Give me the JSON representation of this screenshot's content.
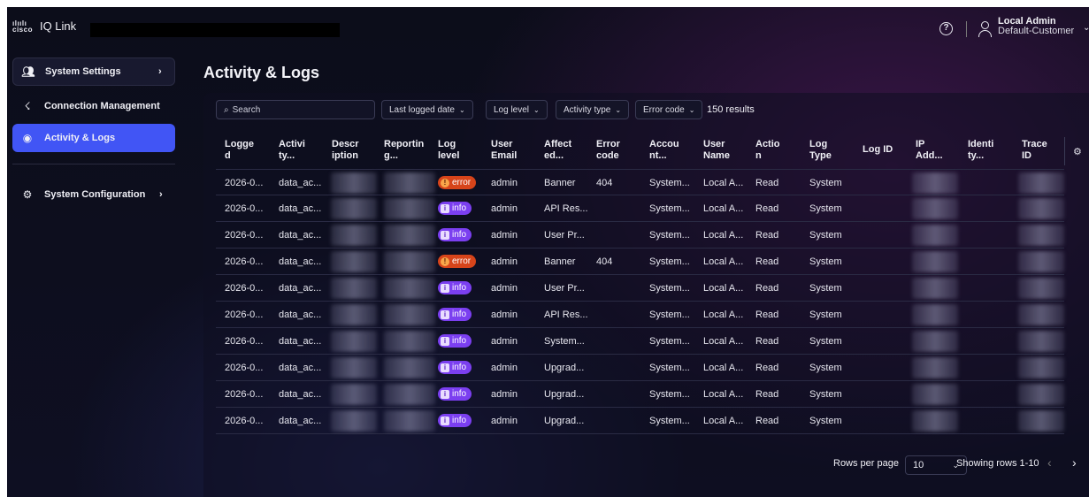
{
  "app": {
    "logo_text": "cisco",
    "name": "IQ Link"
  },
  "header": {
    "user_name": "Local Admin",
    "user_org": "Default-Customer"
  },
  "sidebar": {
    "items": [
      {
        "label": "System Settings",
        "icon": "users-gear-icon"
      },
      {
        "label": "Connection Management",
        "icon": "plug-icon"
      },
      {
        "label": "Activity & Logs",
        "icon": "activity-icon",
        "active": true
      },
      {
        "label": "System Configuration",
        "icon": "gear-icon"
      }
    ]
  },
  "main": {
    "title": "Activity & Logs",
    "search_placeholder": "Search",
    "filters": [
      "Last logged date",
      "Log level",
      "Activity type",
      "Error code"
    ],
    "results_count": "150 results",
    "columns": [
      "Logge d",
      "Activi ty...",
      "Descr iption",
      "Reportin g...",
      "Log level",
      "User Email",
      "Affect ed...",
      "Error code",
      "Accou nt...",
      "User Name",
      "Actio n",
      "Log Type",
      "Log ID",
      "IP Add...",
      "Identi ty...",
      "Trace ID"
    ],
    "rows": [
      {
        "logged": "2026-0...",
        "activity": "data_ac...",
        "level": "error",
        "email": "admin",
        "affected": "Banner",
        "error_code": "404",
        "account": "System...",
        "user_name": "Local A...",
        "action": "Read",
        "log_type": "System"
      },
      {
        "logged": "2026-0...",
        "activity": "data_ac...",
        "level": "info",
        "email": "admin",
        "affected": "API Res...",
        "error_code": "",
        "account": "System...",
        "user_name": "Local A...",
        "action": "Read",
        "log_type": "System"
      },
      {
        "logged": "2026-0...",
        "activity": "data_ac...",
        "level": "info",
        "email": "admin",
        "affected": "User Pr...",
        "error_code": "",
        "account": "System...",
        "user_name": "Local A...",
        "action": "Read",
        "log_type": "System"
      },
      {
        "logged": "2026-0...",
        "activity": "data_ac...",
        "level": "error",
        "email": "admin",
        "affected": "Banner",
        "error_code": "404",
        "account": "System...",
        "user_name": "Local A...",
        "action": "Read",
        "log_type": "System"
      },
      {
        "logged": "2026-0...",
        "activity": "data_ac...",
        "level": "info",
        "email": "admin",
        "affected": "User Pr...",
        "error_code": "",
        "account": "System...",
        "user_name": "Local A...",
        "action": "Read",
        "log_type": "System"
      },
      {
        "logged": "2026-0...",
        "activity": "data_ac...",
        "level": "info",
        "email": "admin",
        "affected": "API Res...",
        "error_code": "",
        "account": "System...",
        "user_name": "Local A...",
        "action": "Read",
        "log_type": "System"
      },
      {
        "logged": "2026-0...",
        "activity": "data_ac...",
        "level": "info",
        "email": "admin",
        "affected": "System...",
        "error_code": "",
        "account": "System...",
        "user_name": "Local A...",
        "action": "Read",
        "log_type": "System"
      },
      {
        "logged": "2026-0...",
        "activity": "data_ac...",
        "level": "info",
        "email": "admin",
        "affected": "Upgrad...",
        "error_code": "",
        "account": "System...",
        "user_name": "Local A...",
        "action": "Read",
        "log_type": "System"
      },
      {
        "logged": "2026-0...",
        "activity": "data_ac...",
        "level": "info",
        "email": "admin",
        "affected": "Upgrad...",
        "error_code": "",
        "account": "System...",
        "user_name": "Local A...",
        "action": "Read",
        "log_type": "System"
      },
      {
        "logged": "2026-0...",
        "activity": "data_ac...",
        "level": "info",
        "email": "admin",
        "affected": "Upgrad...",
        "error_code": "",
        "account": "System...",
        "user_name": "Local A...",
        "action": "Read",
        "log_type": "System"
      }
    ],
    "footer": {
      "rows_per_page_label": "Rows per page",
      "rows_per_page_value": "10",
      "showing": "Showing rows 1-10"
    }
  },
  "colors": {
    "accent": "#4155f5",
    "error_badge": "#d7441a",
    "info_badge": "#7b3ff0"
  }
}
